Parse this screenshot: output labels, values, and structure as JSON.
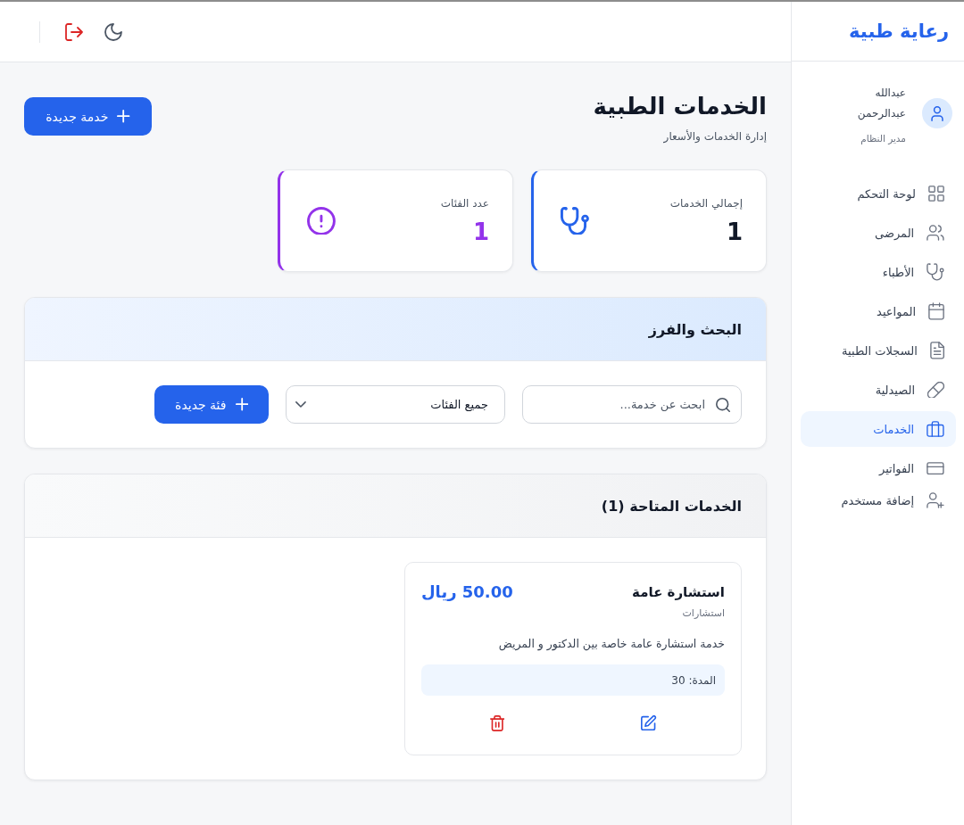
{
  "sidebar": {
    "logo": "رعاية طبية",
    "user": {
      "name": "عبدالله عبدالرحمن",
      "role": "مدير النظام"
    },
    "nav": [
      {
        "label": "لوحة التحكم",
        "selected": false
      },
      {
        "label": "المرضى",
        "selected": false
      },
      {
        "label": "الأطباء",
        "selected": false
      },
      {
        "label": "المواعيد",
        "selected": false
      },
      {
        "label": "السجلات الطبية",
        "selected": false
      },
      {
        "label": "الصيدلية",
        "selected": false
      },
      {
        "label": "الخدمات",
        "selected": true
      },
      {
        "label": "الفواتير",
        "selected": false
      },
      {
        "label": "إضافة مستخدم",
        "selected": false
      }
    ]
  },
  "page": {
    "title": "الخدمات الطبية",
    "subtitle": "إدارة الخدمات والأسعار",
    "new_button": "خدمة جديدة"
  },
  "stats": [
    {
      "kind": "services",
      "label": "إجمالي الخدمات",
      "value": "1",
      "color": "#2563eb"
    },
    {
      "kind": "categories",
      "label": "عدد الفئات",
      "value": "1",
      "color": "#9333ea"
    }
  ],
  "filters": {
    "title": "البحث والفرز",
    "search": {
      "placeholder": "ابحث عن خدمة..."
    },
    "category_select": {
      "value": "جميع الفئات"
    },
    "new_category_button": "فئة جديدة"
  },
  "services": {
    "title": "الخدمات المتاحة (1)",
    "items": [
      {
        "name": "استشارة عامة",
        "category": "استشارات",
        "price": "50.00 ريال",
        "description": "خدمة استشارة عامة خاصة بين الدكتور و المريض",
        "duration": "المدة: 30"
      }
    ]
  }
}
